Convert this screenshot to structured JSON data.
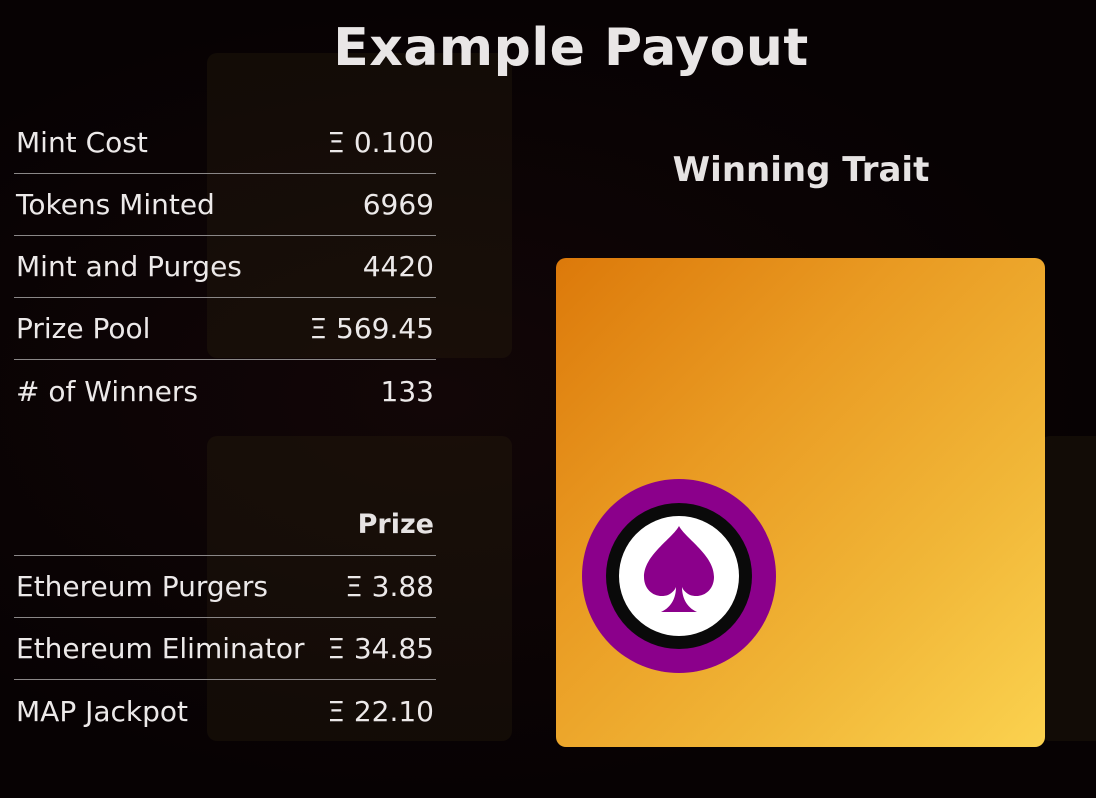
{
  "page": {
    "title": "Example Payout",
    "winning_trait_title": "Winning Trait"
  },
  "stats": [
    {
      "label": "Mint Cost",
      "value": "Ξ 0.100"
    },
    {
      "label": "Tokens Minted",
      "value": "6969"
    },
    {
      "label": "Mint and Purges",
      "value": "4420"
    },
    {
      "label": "Prize Pool",
      "value": "Ξ 569.45"
    },
    {
      "label": "# of Winners",
      "value": "133"
    }
  ],
  "prizes": {
    "header": "Prize",
    "rows": [
      {
        "label": "Ethereum Purgers",
        "value": "Ξ 3.88"
      },
      {
        "label": "Ethereum Eliminator",
        "value": "Ξ 34.85"
      },
      {
        "label": "MAP Jackpot",
        "value": "Ξ 22.10"
      }
    ]
  },
  "trait": {
    "icon": "spade-icon",
    "badge_color": "#8b008b",
    "card_gradient": [
      "#dc790a",
      "#fbd24f"
    ]
  }
}
